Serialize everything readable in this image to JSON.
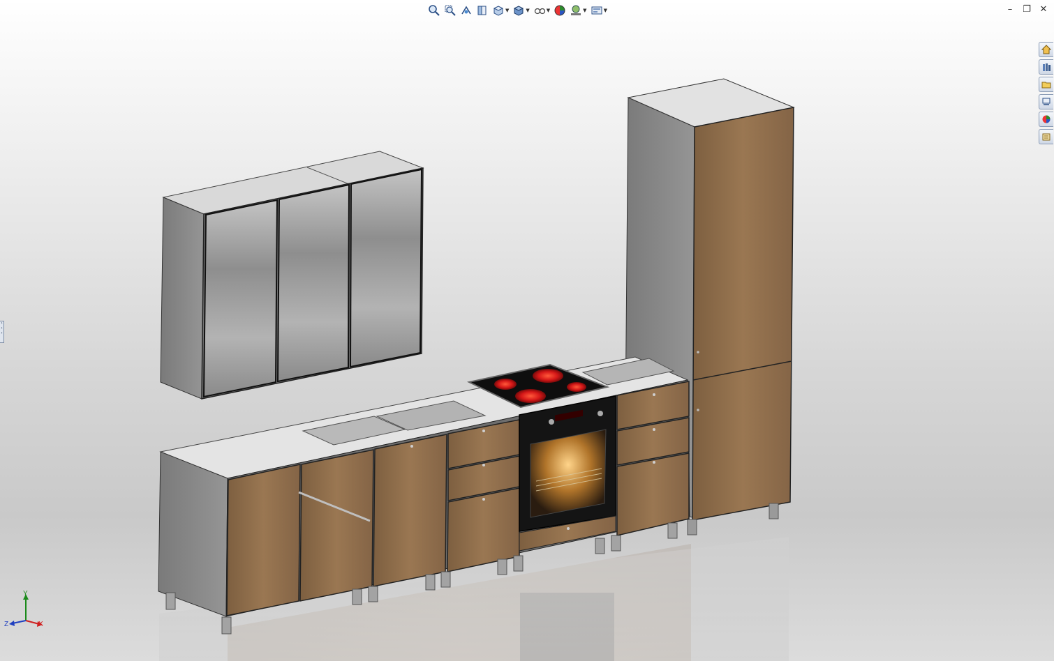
{
  "heads_up_toolbar": [
    {
      "name": "zoom-to-fit-icon"
    },
    {
      "name": "zoom-to-area-icon"
    },
    {
      "name": "previous-view-icon"
    },
    {
      "name": "section-view-icon"
    },
    {
      "name": "view-orientation-icon",
      "dropdown": true
    },
    {
      "name": "display-style-icon",
      "dropdown": true
    },
    {
      "name": "hide-show-items-icon",
      "dropdown": true
    },
    {
      "name": "edit-appearance-icon"
    },
    {
      "name": "apply-scene-icon",
      "dropdown": true
    },
    {
      "name": "view-settings-icon",
      "dropdown": true
    }
  ],
  "window_controls": {
    "minimize": "–",
    "restore": "❐",
    "close": "✕"
  },
  "task_pane": [
    "home-icon",
    "design-library-icon",
    "file-explorer-icon",
    "view-palette-icon",
    "appearances-icon",
    "custom-properties-icon"
  ],
  "triad": {
    "x_label": "X",
    "y_label": "Y",
    "z_label": "Z",
    "x_color": "#d02020",
    "y_color": "#1a8a1a",
    "z_color": "#2040c0"
  },
  "model": {
    "description_hidden": true,
    "wood_color": "#8f6d4a",
    "carcass_color": "#8a8a8a",
    "glass_color": "#9c9c9c",
    "countertop_color": "#e6e6e6"
  }
}
